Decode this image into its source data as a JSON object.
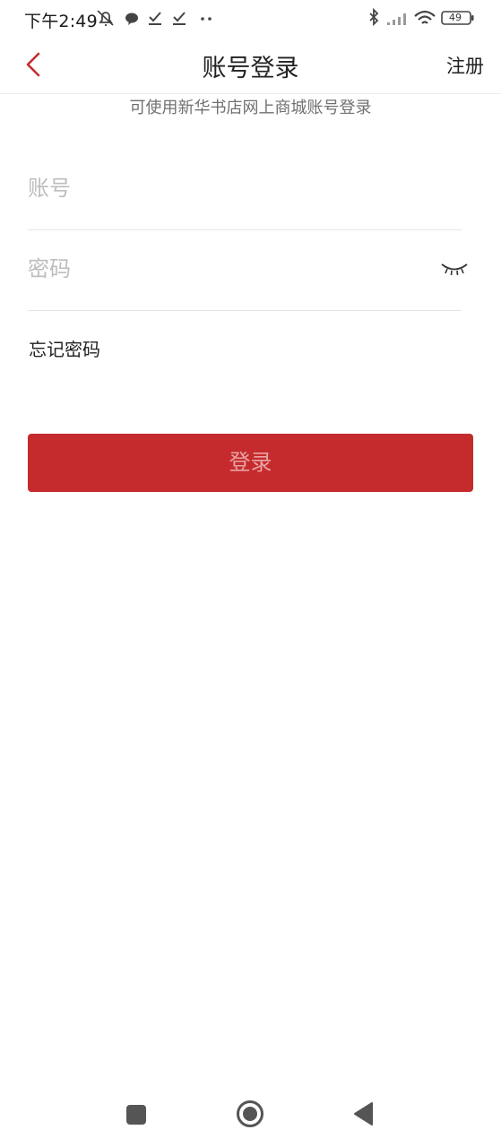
{
  "status_bar": {
    "time": "下午2:49",
    "battery": "49"
  },
  "nav": {
    "title": "账号登录",
    "register_label": "注册"
  },
  "hint": "可使用新华书店网上商城账号登录",
  "form": {
    "account_placeholder": "账号",
    "password_placeholder": "密码",
    "forgot_label": "忘记密码",
    "login_label": "登录"
  },
  "colors": {
    "brand_red": "#c52b2d",
    "back_arrow": "#c52b2d"
  },
  "icons": {
    "back": "chevron-left-icon",
    "password_visibility": "eye-closed-icon",
    "nav_recent": "square-icon",
    "nav_home": "circle-icon",
    "nav_back": "triangle-left-icon"
  }
}
